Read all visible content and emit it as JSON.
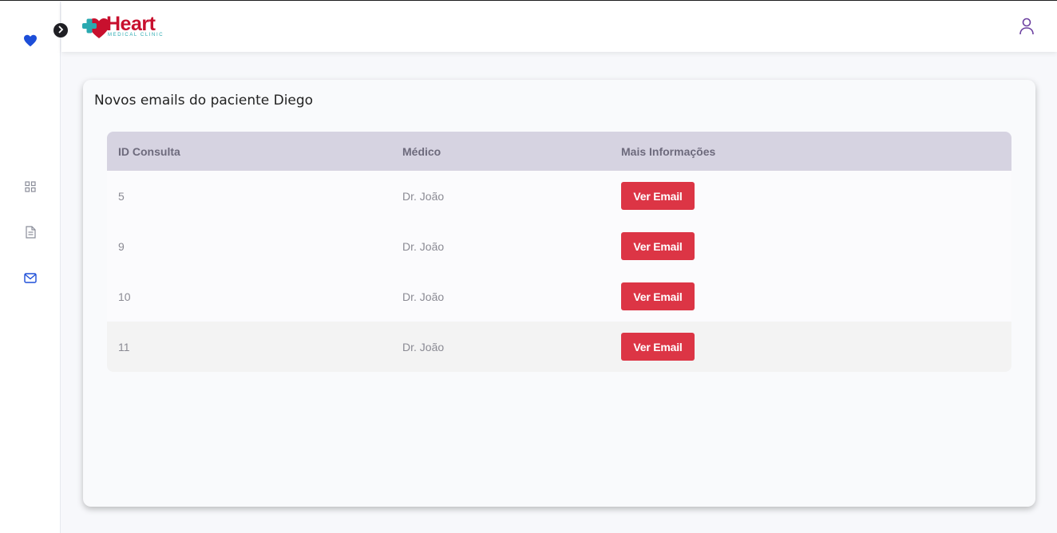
{
  "brand": {
    "name": "Heart",
    "tagline": "MEDICAL CLINIC",
    "color": "#c8102e",
    "accent": "#2aa9b0"
  },
  "sidebar": {
    "items": [
      {
        "icon": "heart-icon",
        "active": true
      },
      {
        "icon": "dashboard-grid-icon",
        "active": false
      },
      {
        "icon": "document-icon",
        "active": false
      },
      {
        "icon": "mail-icon",
        "active": true
      }
    ]
  },
  "main": {
    "title": "Novos emails do paciente Diego",
    "table": {
      "headers": [
        "ID Consulta",
        "Médico",
        "Mais Informações"
      ],
      "rows": [
        {
          "id": "5",
          "doctor": "Dr. João",
          "action": "Ver Email"
        },
        {
          "id": "9",
          "doctor": "Dr. João",
          "action": "Ver Email"
        },
        {
          "id": "10",
          "doctor": "Dr. João",
          "action": "Ver Email"
        },
        {
          "id": "11",
          "doctor": "Dr. João",
          "action": "Ver Email"
        }
      ]
    }
  },
  "colors": {
    "button": "#dc3545",
    "header_row": "#d6d3e1",
    "active_icon": "#1d4ed8",
    "user_icon": "#6b3fa0"
  }
}
